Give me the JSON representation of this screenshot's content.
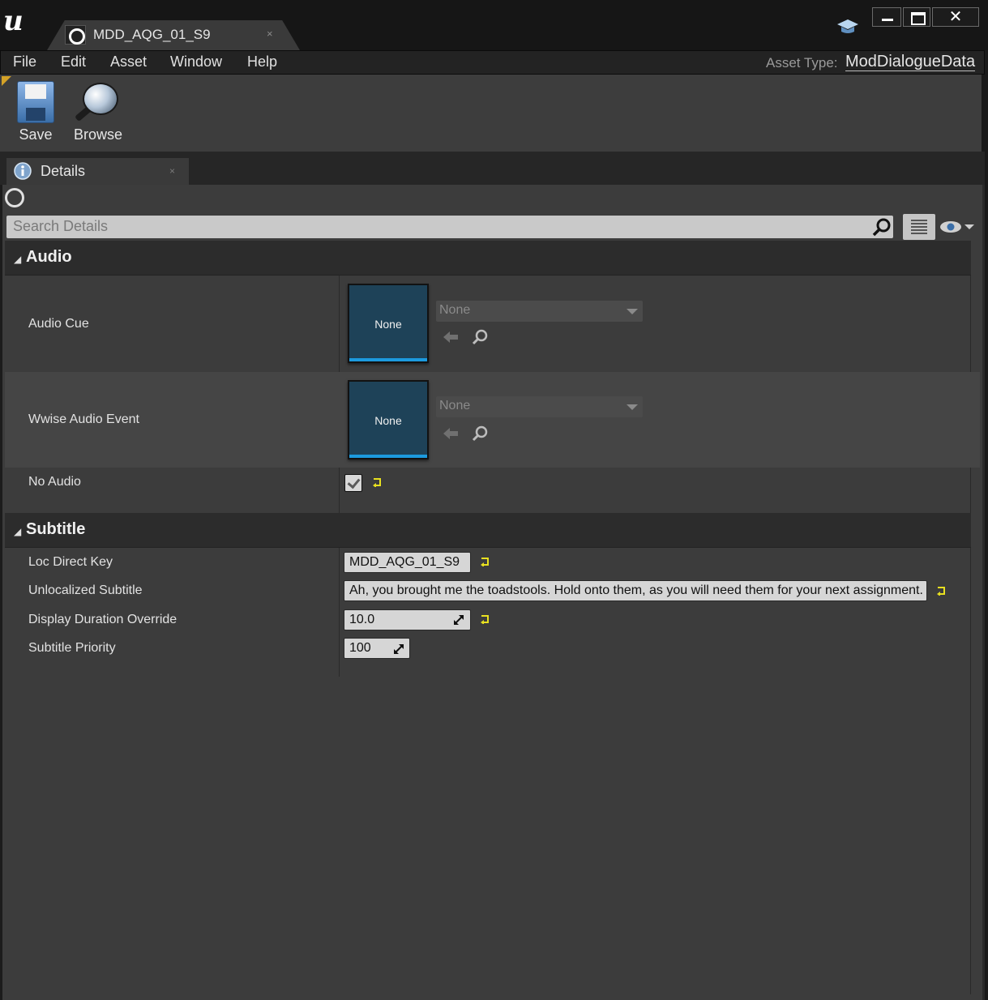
{
  "window": {
    "tab_title": "MDD_AQG_01_S9",
    "tab_close": "×",
    "logo_text": "u"
  },
  "menu": {
    "items": [
      "File",
      "Edit",
      "Asset",
      "Window",
      "Help"
    ],
    "asset_type_label": "Asset Type:",
    "asset_type_value": "ModDialogueData"
  },
  "toolbar": {
    "save_label": "Save",
    "browse_label": "Browse"
  },
  "details": {
    "tab_label": "Details",
    "tab_close": "×",
    "search_placeholder": "Search Details"
  },
  "categories": {
    "audio": {
      "label": "Audio",
      "audio_cue": {
        "label": "Audio Cue",
        "thumb": "None",
        "combo": "None"
      },
      "wwise_event": {
        "label": "Wwise Audio Event",
        "thumb": "None",
        "combo": "None"
      },
      "no_audio": {
        "label": "No Audio",
        "checked": true
      }
    },
    "subtitle": {
      "label": "Subtitle",
      "loc_direct_key": {
        "label": "Loc Direct Key",
        "value": "MDD_AQG_01_S9"
      },
      "unlocalized_subtitle": {
        "label": "Unlocalized Subtitle",
        "value": "Ah, you brought me the toadstools. Hold onto them, as you will need them for your next assignment."
      },
      "display_duration": {
        "label": "Display Duration Override",
        "value": "10.0"
      },
      "priority": {
        "label": "Subtitle Priority",
        "value": "100"
      }
    }
  },
  "colors": {
    "accent_blue": "#1c9ade",
    "thumb_bg": "#1e4258",
    "reset_yellow": "#e8e020",
    "toolbar_corner": "#d4a227"
  }
}
